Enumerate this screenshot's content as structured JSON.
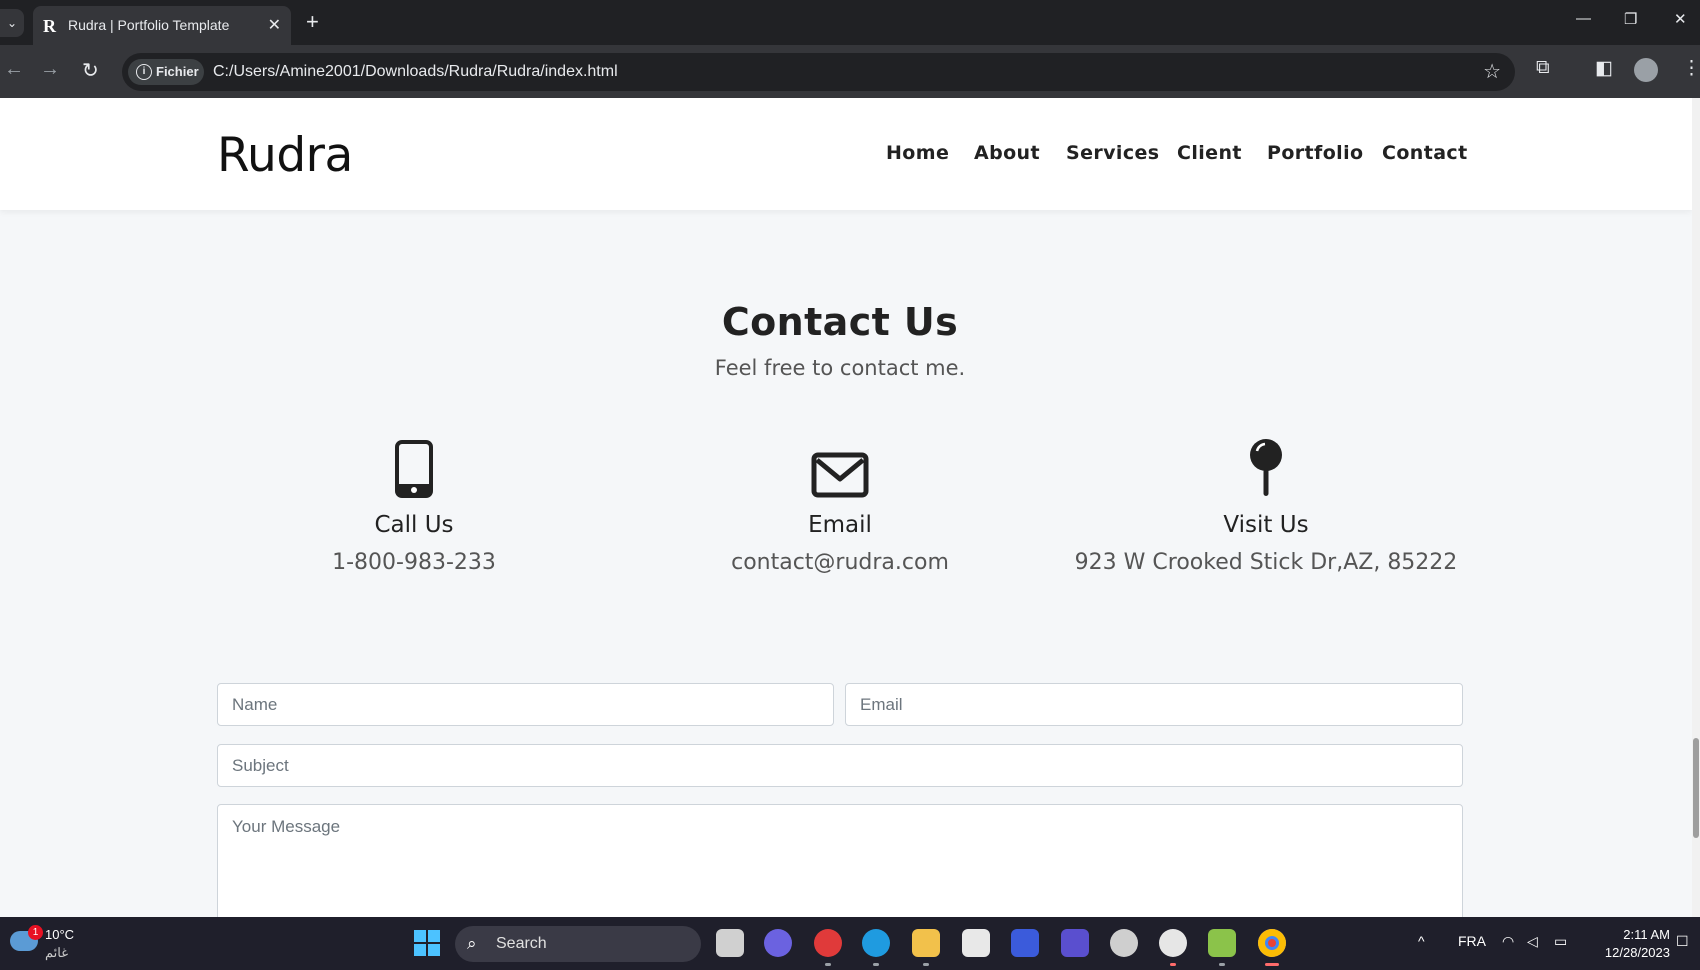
{
  "browser": {
    "tab_title": "Rudra | Portfolio Template",
    "tab_favicon": "R",
    "address_chip": "Fichier",
    "url": "C:/Users/Amine2001/Downloads/Rudra/Rudra/index.html"
  },
  "site": {
    "brand": "Rudra",
    "nav": [
      "Home",
      "About",
      "Services",
      "Client",
      "Portfolio",
      "Contact"
    ]
  },
  "contact": {
    "title": "Contact Us",
    "subtitle": "Feel free to contact me.",
    "info": [
      {
        "icon": "phone-icon",
        "title": "Call Us",
        "value": "1-800-983-233"
      },
      {
        "icon": "envelope-icon",
        "title": "Email",
        "value": "contact@rudra.com"
      },
      {
        "icon": "map-pin-icon",
        "title": "Visit Us",
        "value": "923 W Crooked Stick Dr,AZ, 85222"
      }
    ],
    "form": {
      "name_placeholder": "Name",
      "email_placeholder": "Email",
      "subject_placeholder": "Subject",
      "message_placeholder": "Your Message"
    }
  },
  "taskbar": {
    "temperature": "10°C",
    "weather_condition": "غائم",
    "weather_badge": "1",
    "search_label": "Search",
    "language": "FRA",
    "time": "2:11 AM",
    "date": "12/28/2023"
  }
}
